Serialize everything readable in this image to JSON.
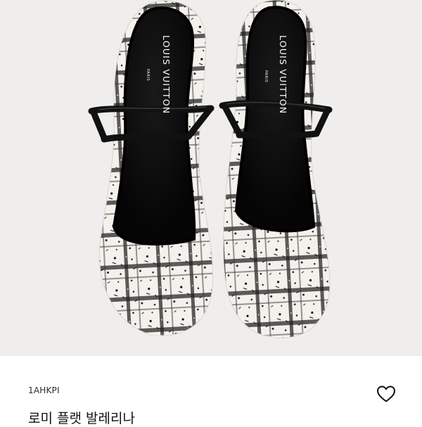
{
  "product": {
    "brand_mark": "LOUIS VUITTON",
    "brand_city": "PARIS",
    "sku": "1AHKPI",
    "name": "로미 플랫 발레리나",
    "wishlist_icon": "heart-outline-icon"
  },
  "colors": {
    "background": "#ffffff",
    "photo_background": "#efeeec",
    "tweed_base": "#f4f1ec",
    "tweed_check": "#1a1a1a",
    "lining": "#0c0c0c",
    "patent_strap": "#111111"
  }
}
